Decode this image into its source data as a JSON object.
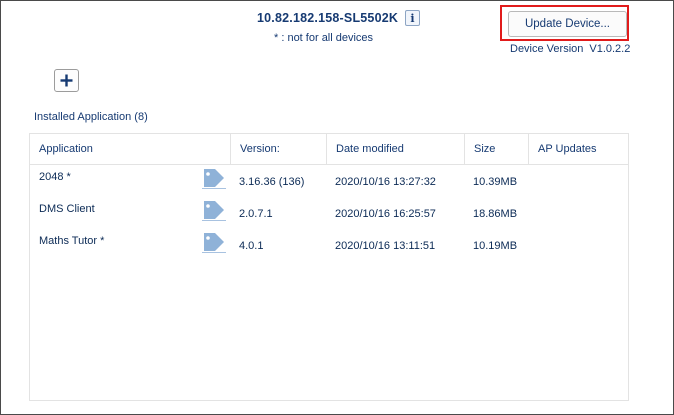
{
  "header": {
    "device_name": "10.82.182.158-SL5502K",
    "info_icon_glyph": "i",
    "not_all_note": "* : not for all devices",
    "update_button_label": "Update Device...",
    "device_version_label": "Device Version",
    "device_version_value": "V1.0.2.2",
    "highlight_color": "#e11b1b"
  },
  "toolbar": {
    "add_icon": "plus-icon"
  },
  "installed": {
    "label": "Installed Application (8)"
  },
  "table": {
    "columns": [
      "Application",
      "Version:",
      "Date modified",
      "Size",
      "AP Updates"
    ],
    "rows": [
      {
        "name": "2048  *",
        "version": "3.16.36 (136)",
        "date": "2020/10/16 13:27:32",
        "size": "10.39MB",
        "ap_updates": "",
        "icon": "tag-icon"
      },
      {
        "name": "DMS Client",
        "version": "2.0.7.1",
        "date": "2020/10/16 16:25:57",
        "size": "18.86MB",
        "ap_updates": "",
        "icon": "tag-icon"
      },
      {
        "name": "Maths Tutor  *",
        "version": "4.0.1",
        "date": "2020/10/16 13:11:51",
        "size": "10.19MB",
        "ap_updates": "",
        "icon": "tag-icon"
      }
    ]
  }
}
